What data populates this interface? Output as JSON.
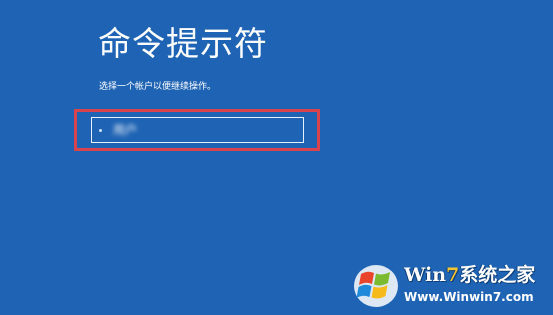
{
  "screen": {
    "title": "命令提示符",
    "subtitle": "选择一个帐户以便继续操作。"
  },
  "account": {
    "name": "用户"
  },
  "watermark": {
    "brand_prefix": "Win",
    "brand_seven": "7",
    "brand_suffix": "系统之家",
    "url": "Www.Winwin7.com",
    "logo_icon": "windows-logo-icon"
  },
  "colors": {
    "background": "#1f64b4",
    "highlight": "#d9434e",
    "text": "#ffffff"
  }
}
